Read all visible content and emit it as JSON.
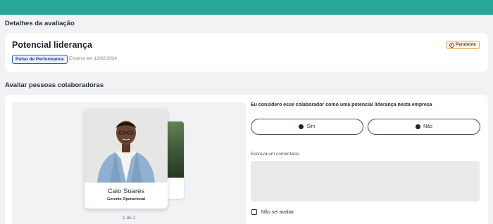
{
  "header": {
    "bar_color": "#27a79a"
  },
  "details": {
    "section_title": "Detalhes da avaliação",
    "title": "Potencial liderança",
    "tag": "Pulso de Performance",
    "deadline": "Encerra em 12/02/2024",
    "status": "Pendente",
    "status_icon": "clock-icon"
  },
  "evaluate": {
    "section_title": "Avaliar pessoas colaboradoras",
    "person": {
      "name": "Caio Soares",
      "role": "Gerente Operacional"
    },
    "pager": "1 de 2",
    "question": "Eu considero esse colaborador como uma potencial liderança nesta empresa",
    "options": [
      {
        "label": "Sim"
      },
      {
        "label": "Não"
      }
    ],
    "comment_label": "Escreva um comentário",
    "comment_value": "",
    "dont_know_label": "Não sei avaliar"
  },
  "colors": {
    "accent": "#27a79a",
    "pending_border": "#d7a24a",
    "tag_border": "#3a5ba8"
  }
}
